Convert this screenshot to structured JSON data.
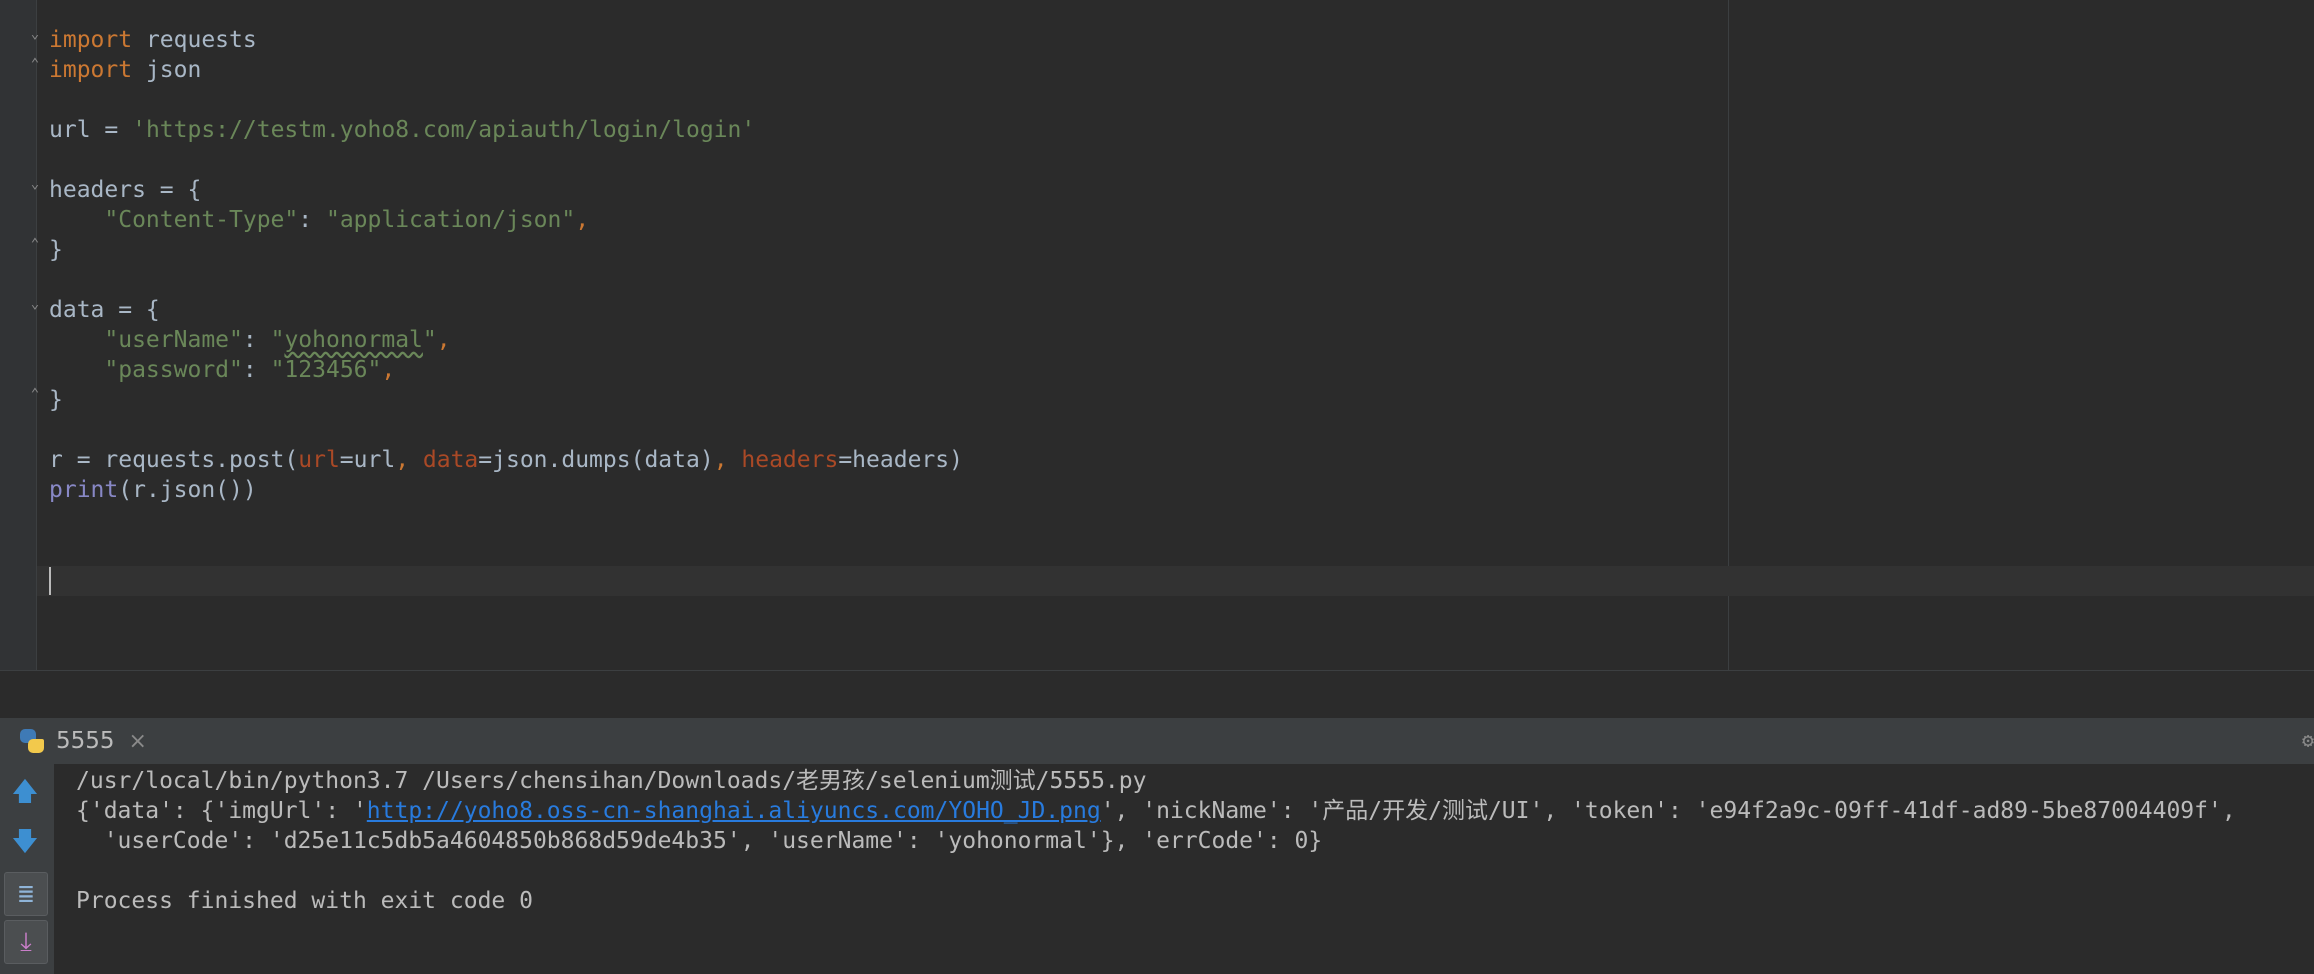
{
  "editor": {
    "lines": [
      {
        "t1": "import",
        "t2": " requests"
      },
      {
        "t1": "import",
        "t2": " json"
      },
      {},
      {
        "t1": "url = ",
        "t2": "'https://testm.yoho8.com/apiauth/login/login'"
      },
      {},
      {
        "t1": "headers = {"
      },
      {
        "t1": "    ",
        "t2": "\"Content-Type\"",
        "t3": ": ",
        "t4": "\"application/json\"",
        "t5": ","
      },
      {
        "t1": "}"
      },
      {},
      {
        "t1": "data = {"
      },
      {
        "t1": "    ",
        "t2": "\"userName\"",
        "t3": ": ",
        "t4": "\"",
        "t5": "yohonormal",
        "t6": "\"",
        "t7": ","
      },
      {
        "t1": "    ",
        "t2": "\"password\"",
        "t3": ": ",
        "t4": "\"123456\"",
        "t5": ","
      },
      {
        "t1": "}"
      },
      {},
      {
        "t1": "r = requests.post(",
        "t2": "url",
        "t3": "=url",
        "t4": ", ",
        "t5": "data",
        "t6": "=json.dumps(data)",
        "t7": ", ",
        "t8": "headers",
        "t9": "=headers)"
      },
      {
        "t1": "print",
        "t2": "(r.json())"
      }
    ]
  },
  "run_panel": {
    "tab_label": "5555",
    "tab_close": "×",
    "console": {
      "command": "/usr/local/bin/python3.7 /Users/chensihan/Downloads/老男孩/selenium测试/5555.py",
      "output_prefix": "{'data': {'imgUrl': '",
      "output_link": "http://yoho8.oss-cn-shanghai.aliyuncs.com/YOHO_JD.png",
      "output_suffix": "', 'nickName': '产品/开发/测试/UI', 'token': 'e94f2a9c-09ff-41df-ad89-5be87004409f',",
      "output_line2": "  'userCode': 'd25e11c5db5a4604850b868d59de4b35', 'userName': 'yohonormal'}, 'errCode': 0}",
      "exit_message": "Process finished with exit code 0"
    },
    "tools": [
      "up-arrow-icon",
      "down-arrow-icon",
      "soft-wrap-icon",
      "scroll-to-end-icon"
    ]
  },
  "colors": {
    "editor_bg": "#2b2b2b",
    "keyword": "#cc7832",
    "string": "#6a8759",
    "param": "#aa4926",
    "builtin": "#8888c6",
    "link": "#287bde"
  }
}
